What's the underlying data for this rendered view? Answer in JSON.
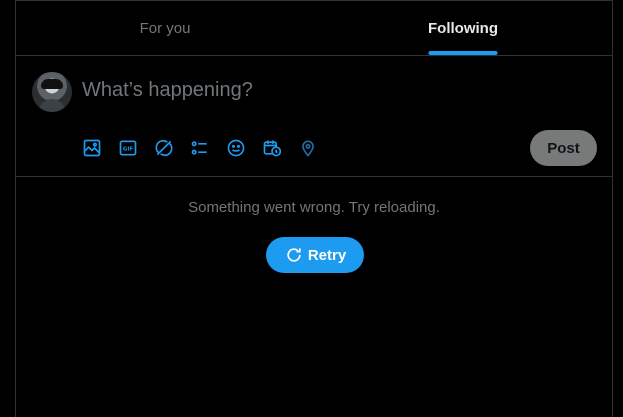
{
  "tabs": [
    {
      "label": "For you",
      "active": false
    },
    {
      "label": "Following",
      "active": true
    }
  ],
  "composer": {
    "placeholder": "What’s happening?",
    "tools": [
      "image-icon",
      "gif-icon",
      "grok-icon",
      "poll-icon",
      "emoji-icon",
      "schedule-icon",
      "location-icon"
    ],
    "post_label": "Post"
  },
  "feed": {
    "error_message": "Something went wrong. Try reloading.",
    "retry_label": "Retry"
  },
  "colors": {
    "accent": "#1d9bf0",
    "background": "#000000",
    "border": "#2f3336",
    "muted_text": "#71767b"
  }
}
